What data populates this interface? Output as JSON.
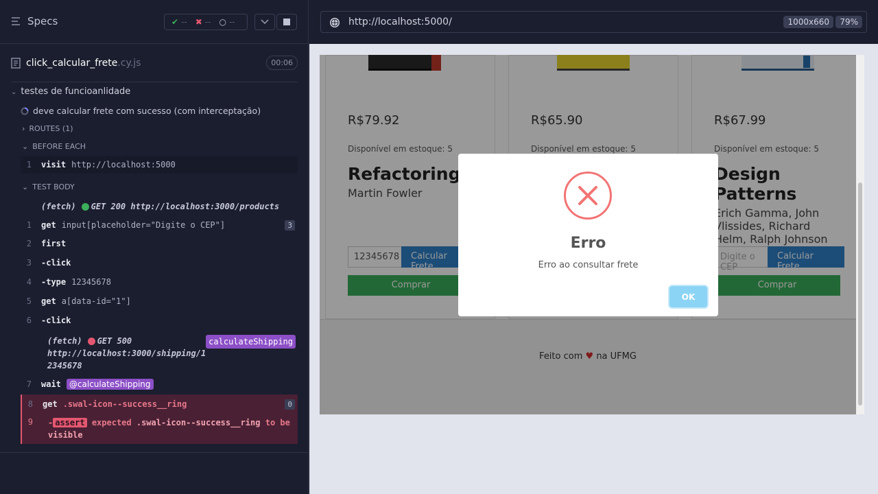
{
  "runner": {
    "specs_label": "Specs",
    "stats": {
      "passed": "--",
      "failed": "--",
      "pending": "--"
    },
    "spec_file": {
      "name": "click_calcular_frete",
      "ext": ".cy.js",
      "duration": "00:06"
    },
    "suite": "testes de funcioanlidade",
    "test": "deve calcular frete com sucesso (com interceptação)",
    "routes_label": "ROUTES (1)",
    "before_each_label": "BEFORE EACH",
    "test_body_label": "TEST BODY",
    "before_each": [
      {
        "num": "1",
        "name": "visit",
        "msg": "http://localhost:5000"
      }
    ],
    "fetch1": {
      "label": "(fetch)",
      "text": "GET 200 http://localhost:3000/products"
    },
    "commands": [
      {
        "num": "1",
        "name": "get",
        "msg": "input[placeholder=\"Digite o CEP\"]",
        "badge": "3"
      },
      {
        "num": "2",
        "name": "first",
        "msg": ""
      },
      {
        "num": "3",
        "name": "-click",
        "msg": ""
      },
      {
        "num": "4",
        "name": "-type",
        "msg": "12345678"
      },
      {
        "num": "5",
        "name": "get",
        "msg": "a[data-id=\"1\"]"
      },
      {
        "num": "6",
        "name": "-click",
        "msg": ""
      }
    ],
    "fetch2": {
      "label": "(fetch)",
      "line1": "GET 500",
      "line2": "http://localhost:3000/shipping/1",
      "line3": "2345678",
      "alias": "calculateShipping"
    },
    "wait": {
      "num": "7",
      "name": "wait",
      "alias": "@calculateShipping"
    },
    "fail_get": {
      "num": "8",
      "name": "get",
      "msg": ".swal-icon--success__ring",
      "badge": "0"
    },
    "fail_assert": {
      "num": "9",
      "prefix": "-",
      "name": "assert",
      "w1": "expected",
      "w2": ".swal-icon--success__ring",
      "w3": "to",
      "w4": "be",
      "w5": "visible"
    }
  },
  "browser": {
    "url": "http://localhost:5000/",
    "viewport": "1000x660",
    "zoom": "79%"
  },
  "app": {
    "products": [
      {
        "price": "R$79.92",
        "stock": "Disponível em estoque: 5",
        "title": "Refactoring",
        "author": "Martin Fowler",
        "cep_value": "12345678",
        "calc_label": "Calcular Frete",
        "buy_label": "Comprar"
      },
      {
        "price": "R$65.90",
        "stock": "Disponível em estoque: 5",
        "title": "",
        "author": "",
        "cep_value": "",
        "calc_label": "",
        "buy_label": ""
      },
      {
        "price": "R$67.99",
        "stock": "Disponível em estoque: 5",
        "title": "Design Patterns",
        "author": "Erich Gamma, John Vlissides, Richard Helm, Ralph Johnson",
        "cep_placeholder": "Digite o CEP",
        "calc_label": "Calcular Frete",
        "buy_label": "Comprar"
      }
    ],
    "footer": {
      "text_before": "Feito com",
      "text_after": "na UFMG"
    },
    "modal": {
      "title": "Erro",
      "text": "Erro ao consultar frete",
      "ok_label": "OK"
    }
  }
}
